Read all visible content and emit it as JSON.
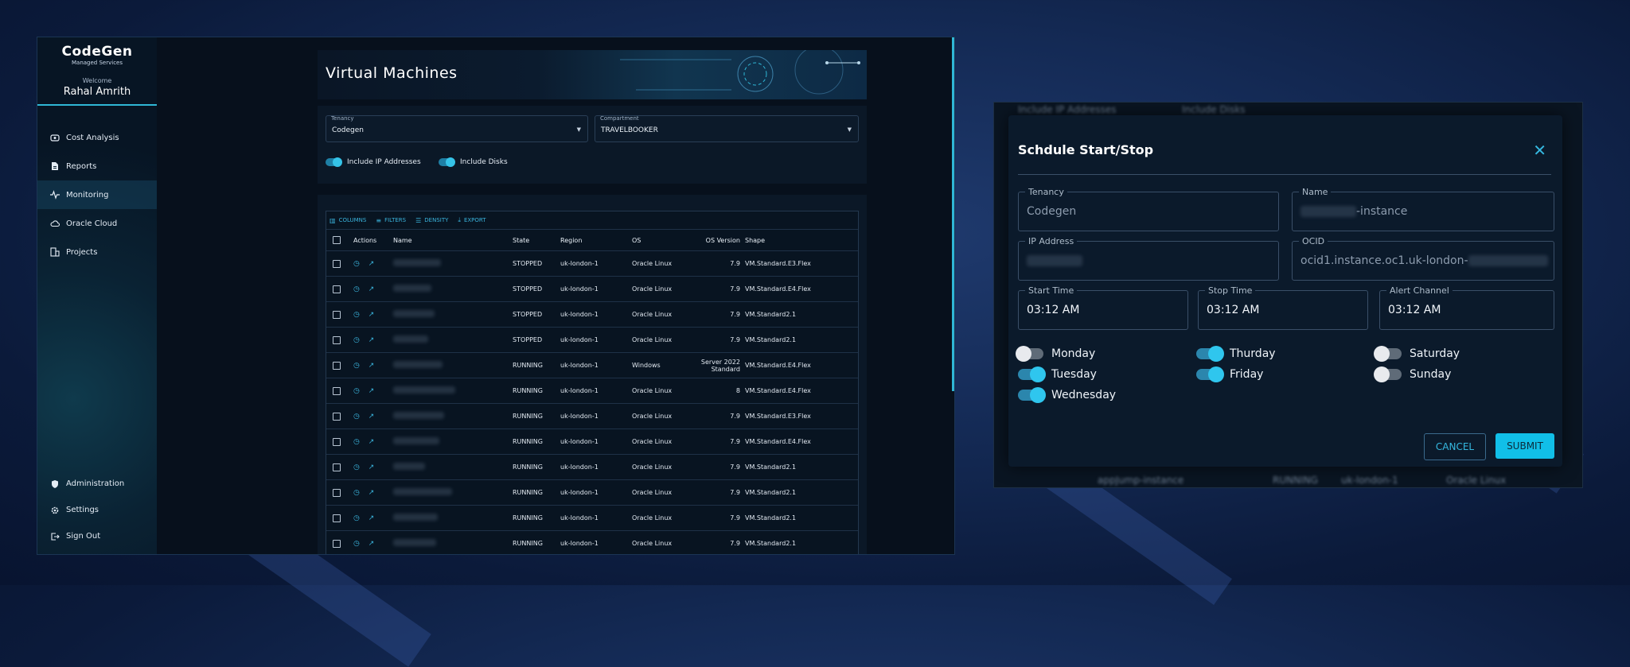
{
  "brand": {
    "title": "CodeGen",
    "subtitle": "Managed Services"
  },
  "user": {
    "welcome": "Welcome",
    "name": "Rahal Amrith"
  },
  "sidebar": {
    "items": [
      {
        "label": "Cost Analysis",
        "icon": "piggy-bank-icon"
      },
      {
        "label": "Reports",
        "icon": "document-icon"
      },
      {
        "label": "Monitoring",
        "icon": "pulse-icon"
      },
      {
        "label": "Oracle Cloud",
        "icon": "cloud-icon"
      },
      {
        "label": "Projects",
        "icon": "projects-icon"
      }
    ],
    "bottom_items": [
      {
        "label": "Administration",
        "icon": "shield-icon"
      },
      {
        "label": "Settings",
        "icon": "gear-icon"
      },
      {
        "label": "Sign Out",
        "icon": "sign-out-icon"
      }
    ]
  },
  "page": {
    "title": "Virtual Machines"
  },
  "filters": {
    "tenancy": {
      "label": "Tenancy",
      "value": "Codegen"
    },
    "compartment": {
      "label": "Compartment",
      "value": "TRAVELBOOKER"
    },
    "include_ip": "Include IP Addresses",
    "include_disks": "Include Disks"
  },
  "toolbar": {
    "columns": "COLUMNS",
    "filters": "FILTERS",
    "density": "DENSITY",
    "export": "EXPORT"
  },
  "table": {
    "headers": {
      "actions": "Actions",
      "name": "Name",
      "state": "State",
      "region": "Region",
      "os": "OS",
      "os_version": "OS Version",
      "shape": "Shape"
    },
    "rows": [
      {
        "state": "STOPPED",
        "region": "uk-london-1",
        "os": "Oracle Linux",
        "os_version": "7.9",
        "shape": "VM.Standard.E3.Flex"
      },
      {
        "state": "STOPPED",
        "region": "uk-london-1",
        "os": "Oracle Linux",
        "os_version": "7.9",
        "shape": "VM.Standard.E4.Flex"
      },
      {
        "state": "STOPPED",
        "region": "uk-london-1",
        "os": "Oracle Linux",
        "os_version": "7.9",
        "shape": "VM.Standard2.1"
      },
      {
        "state": "STOPPED",
        "region": "uk-london-1",
        "os": "Oracle Linux",
        "os_version": "7.9",
        "shape": "VM.Standard2.1"
      },
      {
        "state": "RUNNING",
        "region": "uk-london-1",
        "os": "Windows",
        "os_version": "Server 2022 Standard",
        "shape": "VM.Standard.E4.Flex"
      },
      {
        "state": "RUNNING",
        "region": "uk-london-1",
        "os": "Oracle Linux",
        "os_version": "8",
        "shape": "VM.Standard.E4.Flex"
      },
      {
        "state": "RUNNING",
        "region": "uk-london-1",
        "os": "Oracle Linux",
        "os_version": "7.9",
        "shape": "VM.Standard.E3.Flex"
      },
      {
        "state": "RUNNING",
        "region": "uk-london-1",
        "os": "Oracle Linux",
        "os_version": "7.9",
        "shape": "VM.Standard.E4.Flex"
      },
      {
        "state": "RUNNING",
        "region": "uk-london-1",
        "os": "Oracle Linux",
        "os_version": "7.9",
        "shape": "VM.Standard2.1"
      },
      {
        "state": "RUNNING",
        "region": "uk-london-1",
        "os": "Oracle Linux",
        "os_version": "7.9",
        "shape": "VM.Standard2.1"
      },
      {
        "state": "RUNNING",
        "region": "uk-london-1",
        "os": "Oracle Linux",
        "os_version": "7.9",
        "shape": "VM.Standard2.1"
      },
      {
        "state": "RUNNING",
        "region": "uk-london-1",
        "os": "Oracle Linux",
        "os_version": "7.9",
        "shape": "VM.Standard2.1"
      }
    ]
  },
  "background_blur": {
    "include_ip": "Include IP Addresses",
    "include_disks": "Include Disks",
    "row_name": "appJump-instance",
    "row_state": "RUNNING",
    "row_region": "uk-london-1",
    "row_os": "Oracle Linux"
  },
  "dialog": {
    "title": "Schdule Start/Stop",
    "tenancy": {
      "label": "Tenancy",
      "value": "Codegen"
    },
    "name": {
      "label": "Name",
      "value_suffix": "-instance"
    },
    "ip": {
      "label": "IP Address"
    },
    "ocid": {
      "label": "OCID",
      "value_prefix": "ocid1.instance.oc1.uk-london-"
    },
    "start_time": {
      "label": "Start Time",
      "value": "03:12 AM"
    },
    "stop_time": {
      "label": "Stop Time",
      "value": "03:12 AM"
    },
    "alert_channel": {
      "label": "Alert Channel",
      "value": "03:12 AM"
    },
    "days": [
      {
        "label": "Monday",
        "on": false
      },
      {
        "label": "Tuesday",
        "on": true
      },
      {
        "label": "Wednesday",
        "on": true
      },
      {
        "label": "Thurday",
        "on": true
      },
      {
        "label": "Friday",
        "on": true
      },
      {
        "label": "Saturday",
        "on": false
      },
      {
        "label": "Sunday",
        "on": false
      }
    ],
    "cancel": "CANCEL",
    "submit": "SUBMIT"
  },
  "colors": {
    "accent": "#2fb7d6",
    "submit": "#11bfe8",
    "background": "#142a55"
  }
}
